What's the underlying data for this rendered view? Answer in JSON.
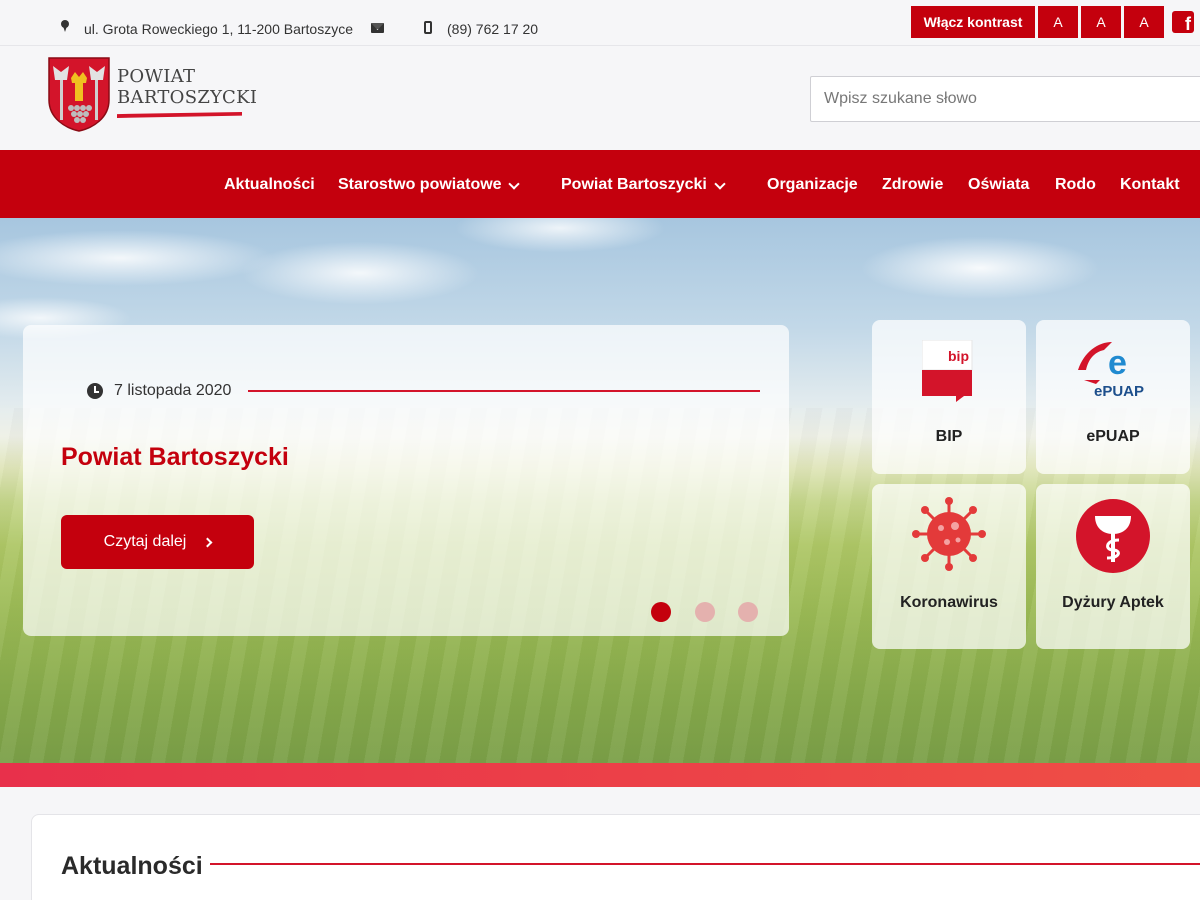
{
  "topbar": {
    "address": "ul. Grota Roweckiego 1, 11-200 Bartoszyce",
    "phone": "(89) 762 17 20",
    "contrast_label": "Włącz kontrast",
    "font_buttons": [
      "A",
      "A",
      "A"
    ],
    "facebook_glyph": "f",
    "icons": [
      "map-marker-icon",
      "envelope-icon",
      "mobile-phone-icon",
      "facebook-icon"
    ]
  },
  "header": {
    "logo_line1": "POWIAT",
    "logo_line2": "BARTOSZYCKI",
    "search_placeholder": "Wpisz szukane słowo"
  },
  "nav": {
    "items": [
      {
        "label": "Aktualności",
        "dropdown": false
      },
      {
        "label": "Starostwo powiatowe",
        "dropdown": true
      },
      {
        "label": "Powiat Bartoszycki",
        "dropdown": true
      },
      {
        "label": "Organizacje",
        "dropdown": false
      },
      {
        "label": "Zdrowie",
        "dropdown": false
      },
      {
        "label": "Oświata",
        "dropdown": false
      },
      {
        "label": "Rodo",
        "dropdown": false
      },
      {
        "label": "Kontakt",
        "dropdown": false
      }
    ]
  },
  "slider": {
    "date": "7 listopada 2020",
    "title": "Powiat Bartoszycki",
    "button_label": "Czytaj dalej",
    "dots": 3,
    "active_dot": 1
  },
  "tiles": [
    {
      "label": "BIP",
      "icon": "bip-logo-icon"
    },
    {
      "label": "ePUAP",
      "icon": "epuap-logo-icon"
    },
    {
      "label": "Koronawirus",
      "icon": "virus-icon"
    },
    {
      "label": "Dyżury Aptek",
      "icon": "pharmacy-icon"
    }
  ],
  "tile_logo_text": {
    "bip": "bip",
    "epuap": "ePUAP",
    "epuap_letter": "e"
  },
  "section": {
    "title": "Aktualności"
  },
  "colors": {
    "brand_red": "#c4000d",
    "accent_line": "#d3142a",
    "strip_start": "#e8304b",
    "strip_end": "#ef4f45"
  }
}
